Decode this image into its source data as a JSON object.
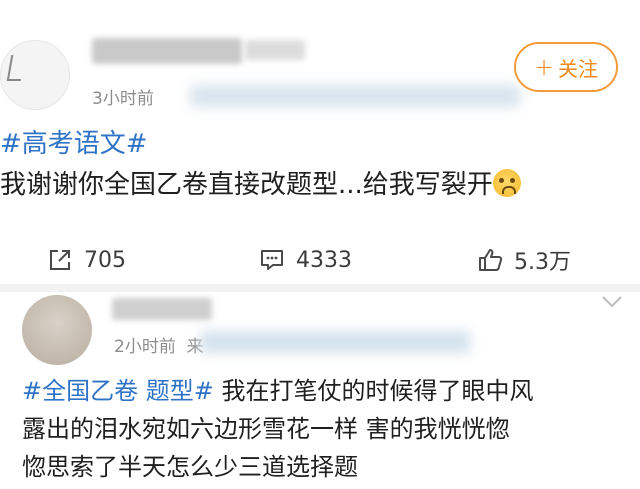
{
  "post": {
    "time": "3小时前",
    "follow_label": "关注",
    "hashtag": "#高考语文#",
    "text": "我谢谢你全国乙卷直接改题型...给我写裂开",
    "emoji": "crying-laughing-emoji",
    "share_count": "705",
    "comment_count": "4333",
    "like_count": "5.3万"
  },
  "comment": {
    "time": "2小时前",
    "source_prefix": "来",
    "hashtag1": "#全国乙卷",
    "hashtag2": "题型#",
    "line1_text": " 我在打笔仗的时候得了眼中风",
    "line2": "露出的泪水宛如六边形雪花一样  害的我恍恍惚",
    "line3": "惚思索了半天怎么少三道选择题"
  },
  "colors": {
    "accent_orange": "#f08a1a",
    "hashtag_blue": "#2f73c7",
    "muted_text": "#8c8c8c"
  },
  "icons": {
    "share": "share-icon",
    "comment": "comment-icon",
    "like": "thumbs-up-icon",
    "plus": "plus-icon",
    "more": "chevron-down-icon"
  }
}
